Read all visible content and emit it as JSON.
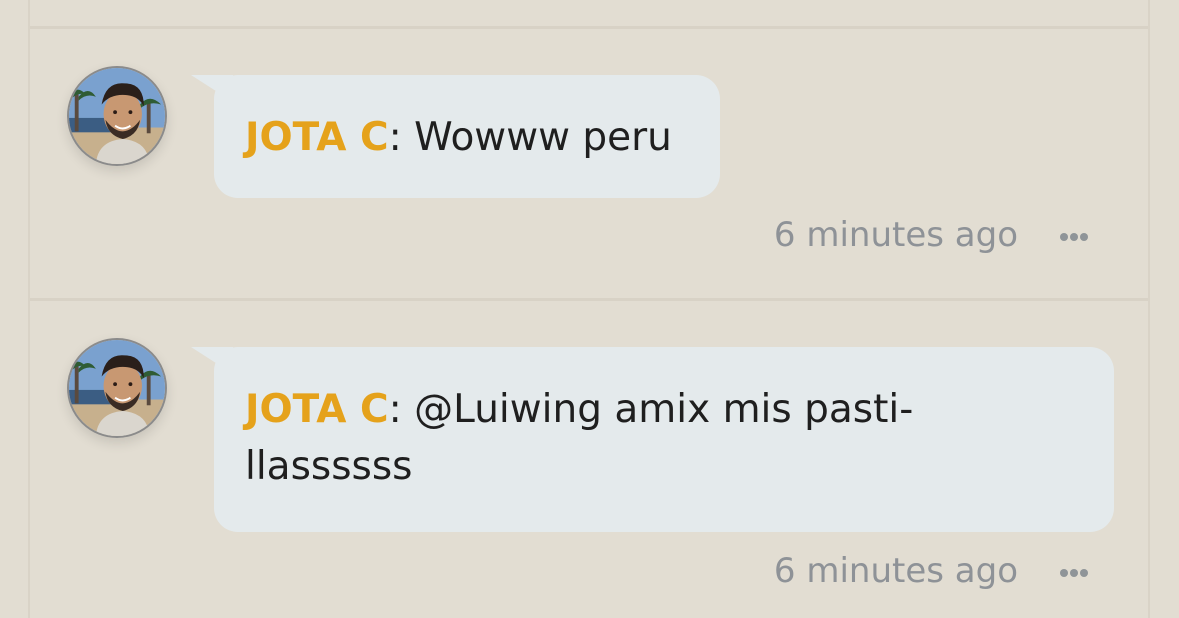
{
  "comments": [
    {
      "author": "JOTA C",
      "message": ": Wowww peru",
      "timestamp": "6 minutes ago",
      "menu_icon": "more-icon"
    },
    {
      "author": "JOTA C",
      "message": ": @Luiwing amix mis pasti-\nllassssss",
      "timestamp": "6 minutes ago",
      "menu_icon": "more-icon"
    }
  ],
  "colors": {
    "background": "#e2ddd2",
    "bubble": "#e4eaec",
    "author": "#e5a21b",
    "timestamp": "#8e9297"
  }
}
